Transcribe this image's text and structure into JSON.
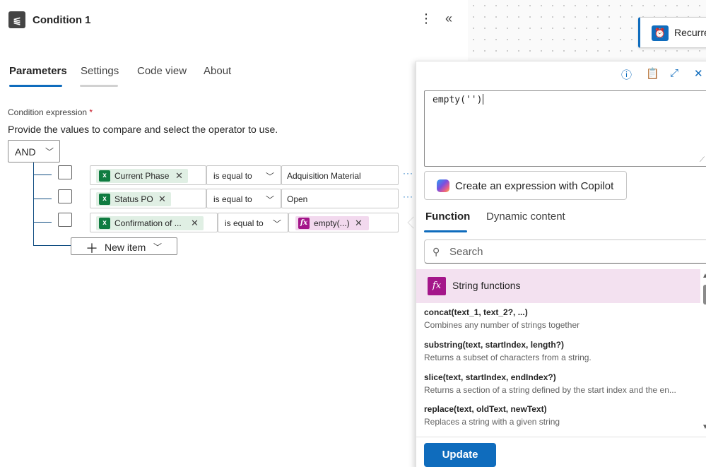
{
  "header": {
    "title": "Condition 1",
    "more_icon": "⋮",
    "collapse_icon": "«"
  },
  "tabs": [
    {
      "label": "Parameters",
      "active": true
    },
    {
      "label": "Settings",
      "active": false
    },
    {
      "label": "Code view",
      "active": false
    },
    {
      "label": "About",
      "active": false
    }
  ],
  "condition": {
    "label": "Condition expression",
    "required_mark": "*",
    "description": "Provide the values to compare and select the operator to use.",
    "group_operator": "AND",
    "rows": [
      {
        "left_token": "Current Phase",
        "left_type": "excel",
        "operator": "is equal to",
        "right_value": "Adquisition Material",
        "checked": false
      },
      {
        "left_token": "Status PO",
        "left_type": "excel",
        "operator": "is equal to",
        "right_value": "Open",
        "checked": false
      },
      {
        "left_token": "Confirmation of ...",
        "left_type": "excel",
        "operator": "is equal to",
        "right_token": "empty(...)",
        "right_type": "expression",
        "checked": false
      }
    ],
    "more_icon": "···",
    "new_item_label": "New item"
  },
  "canvas": {
    "trigger_card_label": "Recurre"
  },
  "expression_editor": {
    "toolbar_icons": [
      "info-icon",
      "clipboard-icon",
      "expand-icon",
      "close-icon"
    ],
    "value": "empty('')",
    "copilot_button_label": "Create an expression with Copilot",
    "tabs": [
      {
        "label": "Function",
        "active": true
      },
      {
        "label": "Dynamic content",
        "active": false
      }
    ],
    "search_placeholder": "Search",
    "category": "String functions",
    "functions": [
      {
        "signature": "concat(text_1, text_2?, ...)",
        "description": "Combines any number of strings together"
      },
      {
        "signature": "substring(text, startIndex, length?)",
        "description": "Returns a subset of characters from a string."
      },
      {
        "signature": "slice(text, startIndex, endIndex?)",
        "description": "Returns a section of a string defined by the start index and the en..."
      },
      {
        "signature": "replace(text, oldText, newText)",
        "description": "Replaces a string with a given string"
      }
    ],
    "update_button_label": "Update"
  },
  "colors": {
    "accent": "#0f6cbd",
    "excel_green": "#107c41",
    "expression_magenta": "#a4168a"
  }
}
